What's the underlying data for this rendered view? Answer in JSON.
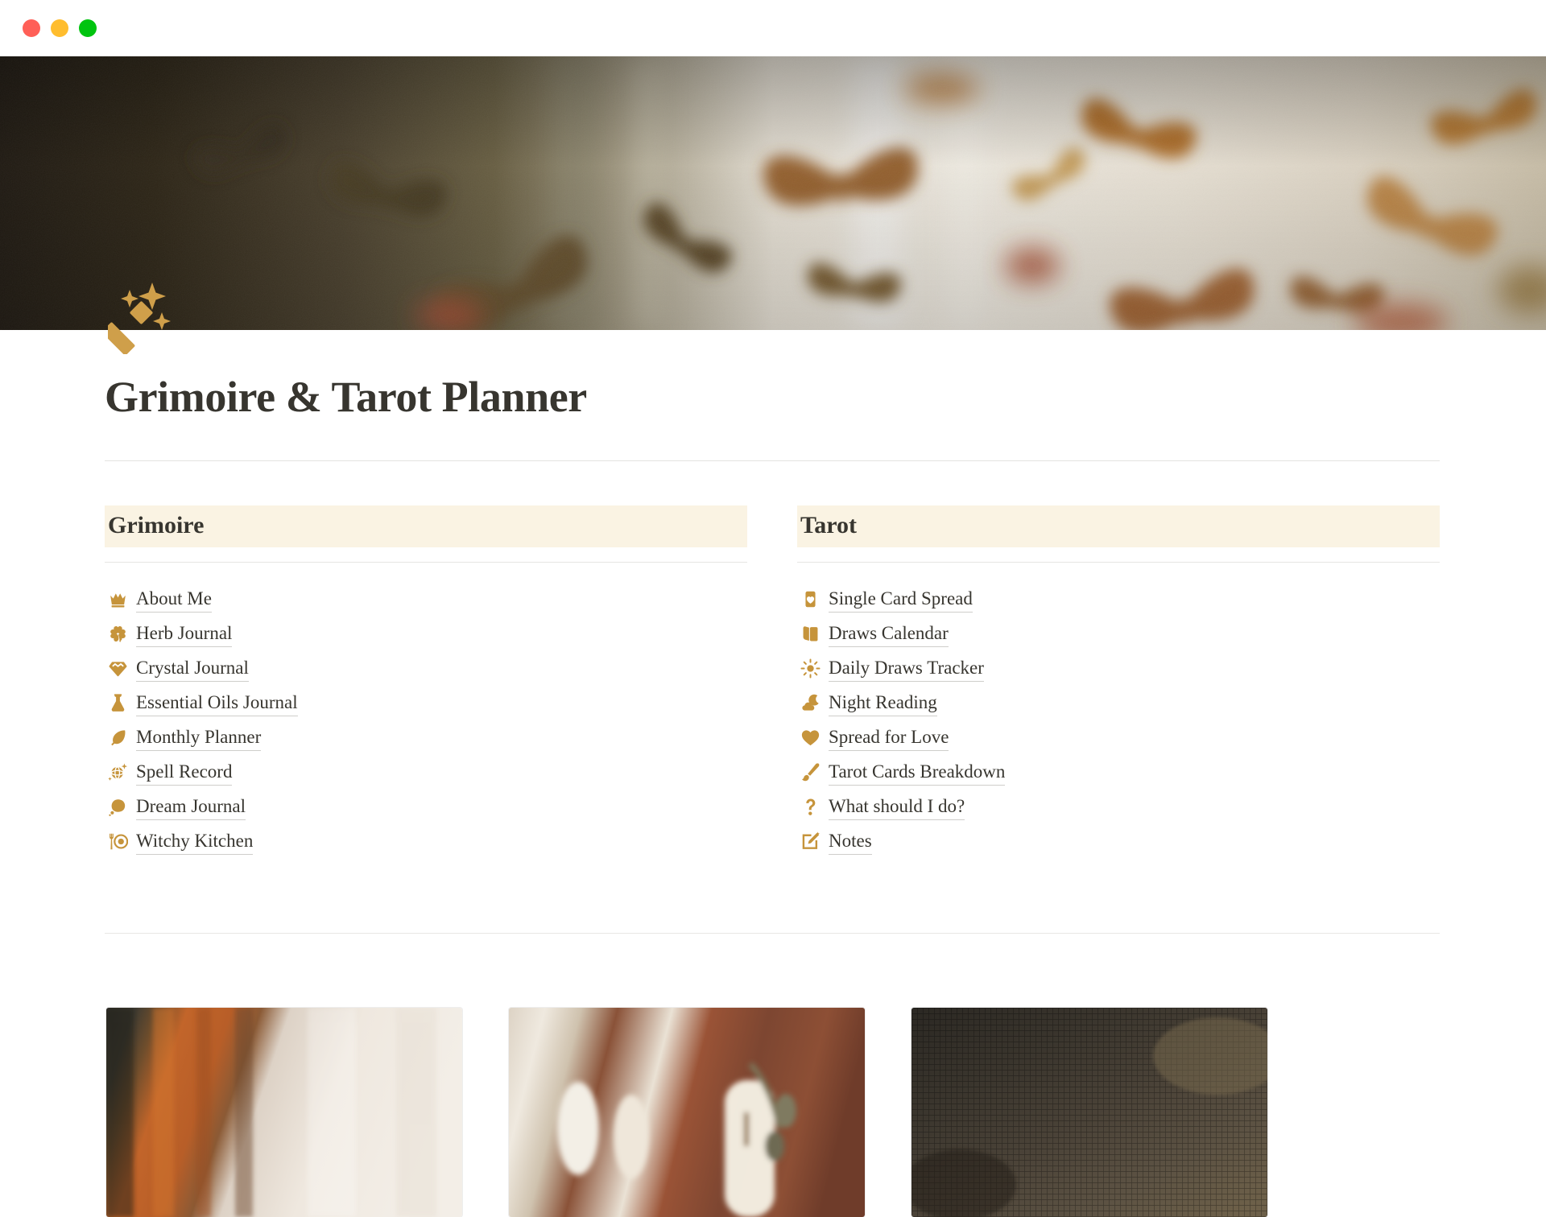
{
  "window": {
    "controls": [
      {
        "name": "close",
        "color": "#ff5f57"
      },
      {
        "name": "minimize",
        "color": "#ffbd2e"
      },
      {
        "name": "maximize",
        "color": "#00c40f"
      }
    ]
  },
  "cover": {
    "name": "cover-image",
    "description": "Blurred photograph of brown and amber butterflies against a cream wall",
    "colors": {
      "dark_left": "#332a20",
      "olive": "#6b6149",
      "cream": "#f2ece2",
      "butterfly_brown": "#9a6430",
      "butterfly_amber": "#c98a3c",
      "accent_red": "#b8482a"
    }
  },
  "page": {
    "icon": "magic-wand-icon",
    "icon_color": "#cf9f4a",
    "title": "Grimoire & Tarot Planner",
    "title_color": "#37352f"
  },
  "theme": {
    "highlight_bg": "#faf3e3",
    "icon_gold": "#c6943b",
    "divider": "#e4e3e0",
    "link_underline": "#cfcecb"
  },
  "columns": [
    {
      "id": "grimoire",
      "heading": "Grimoire",
      "links": [
        {
          "icon": "crown-icon",
          "label": "About Me"
        },
        {
          "icon": "clover-icon",
          "label": "Herb Journal"
        },
        {
          "icon": "gem-icon",
          "label": "Crystal Journal"
        },
        {
          "icon": "flask-icon",
          "label": "Essential Oils Journal"
        },
        {
          "icon": "feather-icon",
          "label": "Monthly Planner"
        },
        {
          "icon": "crystal-ball-icon",
          "label": "Spell Record"
        },
        {
          "icon": "thought-bubble-icon",
          "label": "Dream Journal"
        },
        {
          "icon": "fork-plate-icon",
          "label": "Witchy Kitchen"
        }
      ]
    },
    {
      "id": "tarot",
      "heading": "Tarot",
      "links": [
        {
          "icon": "card-heart-icon",
          "label": "Single Card Spread"
        },
        {
          "icon": "card-stack-icon",
          "label": "Draws Calendar"
        },
        {
          "icon": "sun-icon",
          "label": "Daily Draws Tracker"
        },
        {
          "icon": "moon-cloud-icon",
          "label": "Night Reading"
        },
        {
          "icon": "heart-icon",
          "label": "Spread for Love"
        },
        {
          "icon": "paintbrush-icon",
          "label": "Tarot Cards Breakdown"
        },
        {
          "icon": "question-mark-icon",
          "label": "What should I do?"
        },
        {
          "icon": "edit-square-icon",
          "label": "Notes"
        }
      ]
    }
  ],
  "gallery": [
    {
      "name": "gallery-card-1",
      "description": "Orange knit fabric and mesh beside soft white cloth",
      "colors": {
        "a": "#3b3a33",
        "b": "#c2652a",
        "c": "#e6ddd3",
        "d": "#f1ebe4"
      }
    },
    {
      "name": "gallery-card-2",
      "description": "Lit candle in a glass holder on rust-brown linen with eucalyptus",
      "colors": {
        "a": "#e9e2d7",
        "b": "#8e4b33",
        "c": "#7c6f58",
        "d": "#f6f2ea"
      }
    },
    {
      "name": "gallery-card-3",
      "description": "Dark woven mesh texture",
      "colors": {
        "a": "#2e2b26",
        "b": "#4a443b",
        "c": "#59503f",
        "d": "#6b5f49"
      }
    }
  ]
}
